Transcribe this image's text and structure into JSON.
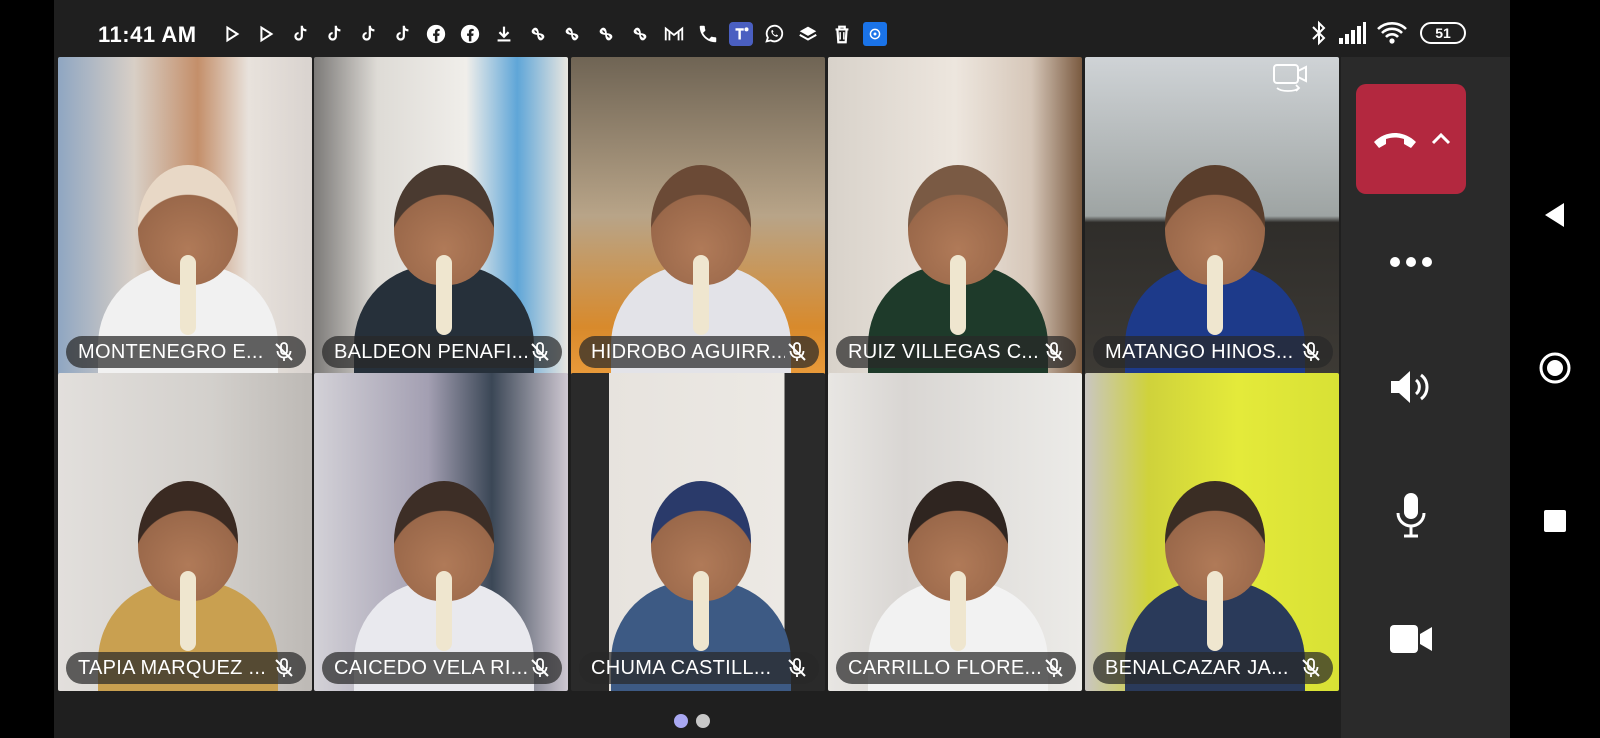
{
  "status_bar": {
    "time": "11:41 AM",
    "battery": "51",
    "notification_icons": [
      "play-icon",
      "play-icon",
      "tiktok-icon",
      "tiktok-icon",
      "tiktok-icon",
      "tiktok-icon",
      "facebook-icon",
      "facebook-icon",
      "download-icon",
      "pinwheel-icon",
      "pinwheel-icon",
      "pinwheel-icon",
      "pinwheel-icon",
      "gmail-icon",
      "phone-icon",
      "teams-icon",
      "whatsapp-icon",
      "stack-icon",
      "trash-icon",
      "app-badge-icon"
    ],
    "system_icons": [
      "bluetooth-icon",
      "signal-icon",
      "wifi-icon"
    ]
  },
  "participants": [
    {
      "name": "MONTENEGRO E...",
      "muted": true,
      "bg": "#c9c2bb"
    },
    {
      "name": "BALDEON PENAFI...",
      "muted": true,
      "bg": "#d7d4cf"
    },
    {
      "name": "HIDROBO AGUIRR...",
      "muted": true,
      "bg": "#8a7a6a"
    },
    {
      "name": "RUIZ VILLEGAS C...",
      "muted": true,
      "bg": "#e3dbd3"
    },
    {
      "name": "MATANGO HINOS...",
      "muted": true,
      "bg": "#3b3a36"
    },
    {
      "name": "TAPIA MARQUEZ ...",
      "muted": true,
      "bg": "#d9d6d3"
    },
    {
      "name": "CAICEDO VELA RI...",
      "muted": true,
      "bg": "#bdb7c4"
    },
    {
      "name": "CHUMA CASTILL...",
      "muted": true,
      "bg": "#2a2a2a"
    },
    {
      "name": "CARRILLO FLORE...",
      "muted": true,
      "bg": "#e6e3e0"
    },
    {
      "name": "BENALCAZAR JA...",
      "muted": true,
      "bg": "#d8e23a"
    }
  ],
  "controls": {
    "hangup": "hangup-button",
    "more": "more-options-button",
    "speaker": "speaker-button",
    "mic": "microphone-button",
    "camera": "camera-button",
    "switch_camera": "switch-camera-icon"
  },
  "colors": {
    "hangup": "#b3283f",
    "panel": "#2a2a2a",
    "page_dot_active": "#a9a8f2",
    "page_dot_inactive": "#c8c8c8"
  },
  "pages": {
    "count": 2,
    "active": 1
  }
}
